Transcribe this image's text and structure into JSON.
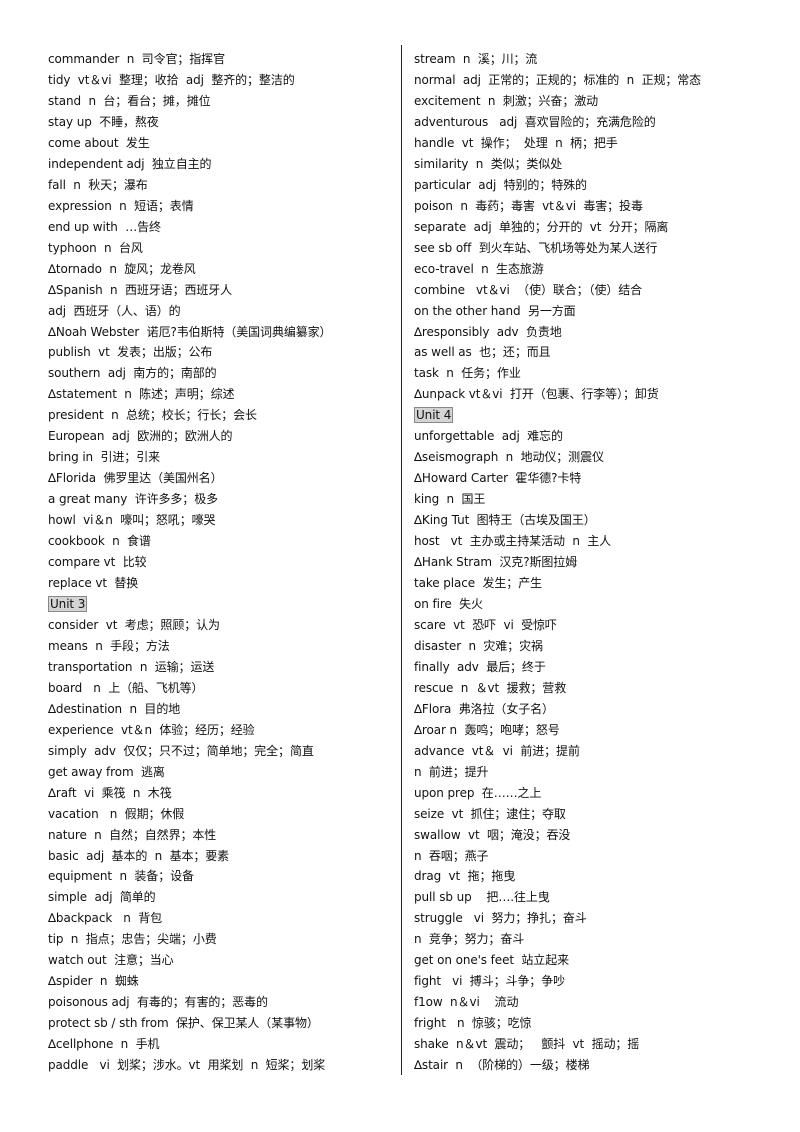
{
  "left_column": [
    "commander  n  司令官；指挥官",
    "tidy  vt＆vi  整理；收拾  adj  整齐的；整洁的",
    "stand  n  台；看台；摊，摊位",
    "stay up  不睡，熬夜",
    "come about  发生",
    "independent adj  独立自主的",
    "fall  n  秋天；瀑布",
    "expression  n  短语；表情",
    "end up with  …告终",
    "typhoon  n  台风",
    "∆tornado  n  旋风；龙卷风",
    "∆Spanish  n  西班牙语；西班牙人",
    "adj  西班牙（人、语）的",
    "∆Noah Webster  诺厄?韦伯斯特（美国词典编纂家）",
    "publish  vt  发表；出版；公布",
    "southern  adj  南方的；南部的",
    "∆statement  n  陈述；声明；综述",
    "president  n  总统；校长；行长；会长",
    "European  adj  欧洲的；欧洲人的",
    "bring in  引进；引来",
    "∆Florida  佛罗里达（美国州名）",
    "a great many  许许多多；极多",
    "howl  vi＆n  嚎叫；怒吼；嚎哭",
    "cookbook  n  食谱",
    "compare vt  比较",
    "replace vt  替换",
    "Unit 3",
    "consider  vt  考虑；照顾；认为",
    "means  n  手段；方法",
    "transportation  n  运输；运送",
    "board   n  上（船、飞机等）",
    "∆destination  n  目的地",
    "experience  vt＆n  体验；经历；经验",
    "simply  adv  仅仅；只不过；简单地；完全；简直",
    "get away from  逃离",
    "∆raft  vi  乘筏  n  木筏",
    "vacation   n  假期；休假",
    "nature  n  自然；自然界；本性",
    "basic  adj  基本的  n  基本；要素",
    "equipment  n  装备；设备",
    "simple  adj  简单的",
    "∆backpack   n  背包",
    "tip  n  指点；忠告；尖端；小费",
    "watch out  注意；当心",
    "∆spider  n  蜘蛛",
    "poisonous adj  有毒的；有害的；恶毒的",
    "protect sb / sth from  保护、保卫某人（某事物）",
    "∆cellphone  n  手机",
    "paddle   vi  划桨；涉水。vt  用桨划  n  短桨；划桨"
  ],
  "right_column": [
    "stream  n  溪；川；流",
    "normal  adj  正常的；正规的；标准的  n  正规；常态",
    "excitement  n  刺激；兴奋；激动",
    "adventurous   adj  喜欢冒险的；充满危险的",
    "handle  vt  操作；  处理  n  柄；把手",
    "similarity  n  类似；类似处",
    "particular  adj  特别的；特殊的",
    "poison  n  毒药；毒害  vt＆vi  毒害；投毒",
    "separate  adj  单独的；分开的  vt  分开；隔离",
    "see sb off  到火车站、飞机场等处为某人送行",
    "eco-travel  n  生态旅游",
    "combine   vt＆vi  （使）联合；（使）结合",
    "on the other hand  另一方面",
    "∆responsibly  adv  负责地",
    "as well as  也；还；而且",
    "task  n  任务；作业",
    "∆unpack vt＆vi  打开（包裹、行李等）；卸货",
    "Unit 4",
    "unforgettable  adj  难忘的",
    "∆seismograph  n  地动仪；测震仪",
    "∆Howard Carter  霍华德?卡特",
    "king  n  国王",
    "∆King Tut  图特王（古埃及国王）",
    "host   vt  主办或主持某活动  n  主人",
    "∆Hank Stram  汉克?斯图拉姆",
    "take place  发生；产生",
    "on fire  失火",
    "scare  vt  恐吓  vi  受惊吓",
    "disaster  n  灾难；灾祸",
    "finally  adv  最后；终于",
    "rescue  n  ＆vt  援救；营救",
    "∆Flora  弗洛拉（女子名）",
    "∆roar n  轰鸣；咆哮；怒号",
    "advance  vt＆  vi  前进；提前",
    "n  前进；提升",
    "upon prep  在……之上",
    "seize  vt  抓住；逮住；夺取",
    "swallow  vt  咽；淹没；吞没",
    "n  吞咽；燕子",
    "drag  vt  拖；拖曳",
    "pull sb up    把….往上曳",
    "struggle   vi  努力；挣扎；奋斗",
    "n  竞争；努力；奋斗",
    "get on one's feet  站立起来",
    "fight   vi  搏斗；斗争；争吵",
    "f1ow  n＆vi    流动",
    "fright   n  惊骇；吃惊",
    "shake  n＆vt  震动；   颤抖  vt  摇动；摇",
    "∆stair  n  （阶梯的）一级；楼梯"
  ],
  "unit_headers": [
    "Unit 3",
    "Unit 4"
  ]
}
